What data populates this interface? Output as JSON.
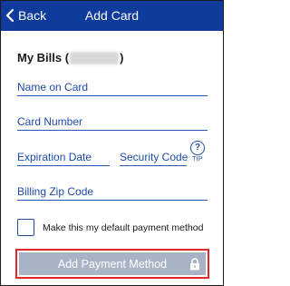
{
  "header": {
    "back_label": "Back",
    "title": "Add Card",
    "back_icon": "chevron-left-icon"
  },
  "account": {
    "prefix": "My Bills (",
    "suffix": ")",
    "redacted": true
  },
  "form": {
    "name_on_card": {
      "label": "Name on Card",
      "value": ""
    },
    "card_number": {
      "label": "Card Number",
      "value": ""
    },
    "expiration_date": {
      "label": "Expiration Date",
      "value": ""
    },
    "security_code": {
      "label": "Security Code",
      "value": ""
    },
    "tip": {
      "symbol": "?",
      "label": "TIP"
    },
    "billing_zip": {
      "label": "Billing Zip Code",
      "value": ""
    },
    "default_checkbox": {
      "label": "Make this my default payment method",
      "checked": false
    },
    "submit": {
      "label": "Add Payment Method",
      "enabled": false,
      "icon": "lock-icon"
    }
  },
  "colors": {
    "header_bg": "#0f3b9c",
    "field_label": "#1f4aa8",
    "button_disabled": "#a8b3c6",
    "highlight_outline": "#e0282b"
  }
}
